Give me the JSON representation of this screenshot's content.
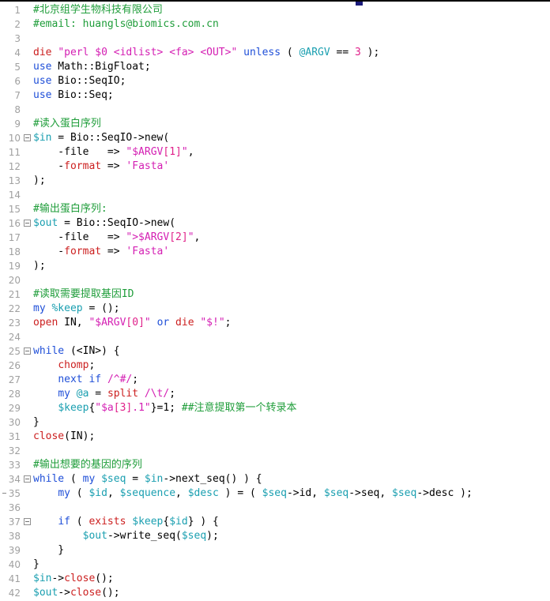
{
  "app": {
    "type": "code-editor",
    "language": "Perl",
    "title": "",
    "top_marker": "tab-marker"
  },
  "colors": {
    "background": "#ffffff",
    "gutter_text": "#a0a0a0",
    "comment": "#1f9d3a",
    "keyword": "#1f4fd8",
    "builtin": "#cc2020",
    "string": "#d41fb3",
    "variable": "#1a9fb0",
    "number": "#e0218a",
    "plain": "#000000",
    "top_marker": "#1a1a7a",
    "fold_border": "#909090"
  },
  "editor": {
    "first_line": 1,
    "last_line": 42,
    "fold_lines": [
      10,
      16,
      25,
      34,
      37
    ],
    "marked_lines": [
      35
    ],
    "lines": [
      {
        "n": 1,
        "tokens": [
          {
            "t": "comment",
            "v": "#北京组学生物科技有限公司"
          }
        ]
      },
      {
        "n": 2,
        "tokens": [
          {
            "t": "comment",
            "v": "#email: huangls@biomics.com.cn"
          }
        ]
      },
      {
        "n": 3,
        "tokens": []
      },
      {
        "n": 4,
        "tokens": [
          {
            "t": "builtin",
            "v": "die"
          },
          {
            "t": "plain",
            "v": " "
          },
          {
            "t": "string",
            "v": "\"perl $0 <idlist> <fa> <OUT>\""
          },
          {
            "t": "plain",
            "v": " "
          },
          {
            "t": "keyword",
            "v": "unless"
          },
          {
            "t": "plain",
            "v": " ( "
          },
          {
            "t": "var",
            "v": "@ARGV"
          },
          {
            "t": "plain",
            "v": " == "
          },
          {
            "t": "num",
            "v": "3"
          },
          {
            "t": "plain",
            "v": " );"
          }
        ]
      },
      {
        "n": 5,
        "tokens": [
          {
            "t": "keyword",
            "v": "use"
          },
          {
            "t": "plain",
            "v": " Math::BigFloat;"
          }
        ]
      },
      {
        "n": 6,
        "tokens": [
          {
            "t": "keyword",
            "v": "use"
          },
          {
            "t": "plain",
            "v": " Bio::SeqIO;"
          }
        ]
      },
      {
        "n": 7,
        "tokens": [
          {
            "t": "keyword",
            "v": "use"
          },
          {
            "t": "plain",
            "v": " Bio::Seq;"
          }
        ]
      },
      {
        "n": 8,
        "tokens": []
      },
      {
        "n": 9,
        "tokens": [
          {
            "t": "comment",
            "v": "#读入蛋白序列"
          }
        ]
      },
      {
        "n": 10,
        "tokens": [
          {
            "t": "var",
            "v": "$in"
          },
          {
            "t": "plain",
            "v": " = Bio::SeqIO->new("
          }
        ]
      },
      {
        "n": 11,
        "tokens": [
          {
            "t": "plain",
            "v": "    -file   => "
          },
          {
            "t": "string",
            "v": "\"$ARGV"
          },
          {
            "t": "num",
            "v": "[1]"
          },
          {
            "t": "string",
            "v": "\""
          },
          {
            "t": "plain",
            "v": ","
          }
        ]
      },
      {
        "n": 12,
        "tokens": [
          {
            "t": "plain",
            "v": "    -"
          },
          {
            "t": "builtin",
            "v": "format"
          },
          {
            "t": "plain",
            "v": " => "
          },
          {
            "t": "string",
            "v": "'Fasta'"
          }
        ]
      },
      {
        "n": 13,
        "tokens": [
          {
            "t": "plain",
            "v": ");"
          }
        ]
      },
      {
        "n": 14,
        "tokens": []
      },
      {
        "n": 15,
        "tokens": [
          {
            "t": "comment",
            "v": "#输出蛋白序列:"
          }
        ]
      },
      {
        "n": 16,
        "tokens": [
          {
            "t": "var",
            "v": "$out"
          },
          {
            "t": "plain",
            "v": " = Bio::SeqIO->new("
          }
        ]
      },
      {
        "n": 17,
        "tokens": [
          {
            "t": "plain",
            "v": "    -file   => "
          },
          {
            "t": "string",
            "v": "\">$ARGV"
          },
          {
            "t": "num",
            "v": "[2]"
          },
          {
            "t": "string",
            "v": "\""
          },
          {
            "t": "plain",
            "v": ","
          }
        ]
      },
      {
        "n": 18,
        "tokens": [
          {
            "t": "plain",
            "v": "    -"
          },
          {
            "t": "builtin",
            "v": "format"
          },
          {
            "t": "plain",
            "v": " => "
          },
          {
            "t": "string",
            "v": "'Fasta'"
          }
        ]
      },
      {
        "n": 19,
        "tokens": [
          {
            "t": "plain",
            "v": ");"
          }
        ]
      },
      {
        "n": 20,
        "tokens": []
      },
      {
        "n": 21,
        "tokens": [
          {
            "t": "comment",
            "v": "#读取需要提取基因ID"
          }
        ]
      },
      {
        "n": 22,
        "tokens": [
          {
            "t": "keyword",
            "v": "my"
          },
          {
            "t": "plain",
            "v": " "
          },
          {
            "t": "var",
            "v": "%keep"
          },
          {
            "t": "plain",
            "v": " = ();"
          }
        ]
      },
      {
        "n": 23,
        "tokens": [
          {
            "t": "builtin",
            "v": "open"
          },
          {
            "t": "plain",
            "v": " IN, "
          },
          {
            "t": "string",
            "v": "\"$ARGV"
          },
          {
            "t": "num",
            "v": "[0]"
          },
          {
            "t": "string",
            "v": "\""
          },
          {
            "t": "plain",
            "v": " "
          },
          {
            "t": "keyword",
            "v": "or"
          },
          {
            "t": "plain",
            "v": " "
          },
          {
            "t": "builtin",
            "v": "die"
          },
          {
            "t": "plain",
            "v": " "
          },
          {
            "t": "string",
            "v": "\"$!\""
          },
          {
            "t": "plain",
            "v": ";"
          }
        ]
      },
      {
        "n": 24,
        "tokens": []
      },
      {
        "n": 25,
        "tokens": [
          {
            "t": "keyword",
            "v": "while"
          },
          {
            "t": "plain",
            "v": " (<IN>) {"
          }
        ]
      },
      {
        "n": 26,
        "tokens": [
          {
            "t": "plain",
            "v": "    "
          },
          {
            "t": "builtin",
            "v": "chomp"
          },
          {
            "t": "plain",
            "v": ";"
          }
        ]
      },
      {
        "n": 27,
        "tokens": [
          {
            "t": "plain",
            "v": "    "
          },
          {
            "t": "keyword",
            "v": "next"
          },
          {
            "t": "plain",
            "v": " "
          },
          {
            "t": "keyword",
            "v": "if"
          },
          {
            "t": "plain",
            "v": " "
          },
          {
            "t": "regex",
            "v": "/^#/"
          },
          {
            "t": "plain",
            "v": ";"
          }
        ]
      },
      {
        "n": 28,
        "tokens": [
          {
            "t": "plain",
            "v": "    "
          },
          {
            "t": "keyword",
            "v": "my"
          },
          {
            "t": "plain",
            "v": " "
          },
          {
            "t": "var",
            "v": "@a"
          },
          {
            "t": "plain",
            "v": " = "
          },
          {
            "t": "builtin",
            "v": "split"
          },
          {
            "t": "plain",
            "v": " "
          },
          {
            "t": "regex",
            "v": "/\\t/"
          },
          {
            "t": "plain",
            "v": ";"
          }
        ]
      },
      {
        "n": 29,
        "tokens": [
          {
            "t": "plain",
            "v": "    "
          },
          {
            "t": "var",
            "v": "$keep"
          },
          {
            "t": "plain",
            "v": "{"
          },
          {
            "t": "string",
            "v": "\"$a"
          },
          {
            "t": "num",
            "v": "[3]"
          },
          {
            "t": "string",
            "v": ".1\""
          },
          {
            "t": "plain",
            "v": "}=1; "
          },
          {
            "t": "comment",
            "v": "##注意提取第一个转录本"
          }
        ]
      },
      {
        "n": 30,
        "tokens": [
          {
            "t": "plain",
            "v": "}"
          }
        ]
      },
      {
        "n": 31,
        "tokens": [
          {
            "t": "builtin",
            "v": "close"
          },
          {
            "t": "plain",
            "v": "(IN);"
          }
        ]
      },
      {
        "n": 32,
        "tokens": []
      },
      {
        "n": 33,
        "tokens": [
          {
            "t": "comment",
            "v": "#输出想要的基因的序列"
          }
        ]
      },
      {
        "n": 34,
        "tokens": [
          {
            "t": "keyword",
            "v": "while"
          },
          {
            "t": "plain",
            "v": " ( "
          },
          {
            "t": "keyword",
            "v": "my"
          },
          {
            "t": "plain",
            "v": " "
          },
          {
            "t": "var",
            "v": "$seq"
          },
          {
            "t": "plain",
            "v": " = "
          },
          {
            "t": "var",
            "v": "$in"
          },
          {
            "t": "plain",
            "v": "->next_seq() ) {"
          }
        ]
      },
      {
        "n": 35,
        "tokens": [
          {
            "t": "plain",
            "v": "    "
          },
          {
            "t": "keyword",
            "v": "my"
          },
          {
            "t": "plain",
            "v": " ( "
          },
          {
            "t": "var",
            "v": "$id"
          },
          {
            "t": "plain",
            "v": ", "
          },
          {
            "t": "var",
            "v": "$sequence"
          },
          {
            "t": "plain",
            "v": ", "
          },
          {
            "t": "var",
            "v": "$desc"
          },
          {
            "t": "plain",
            "v": " ) = ( "
          },
          {
            "t": "var",
            "v": "$seq"
          },
          {
            "t": "plain",
            "v": "->id, "
          },
          {
            "t": "var",
            "v": "$seq"
          },
          {
            "t": "plain",
            "v": "->seq, "
          },
          {
            "t": "var",
            "v": "$seq"
          },
          {
            "t": "plain",
            "v": "->desc );"
          }
        ]
      },
      {
        "n": 36,
        "tokens": []
      },
      {
        "n": 37,
        "tokens": [
          {
            "t": "plain",
            "v": "    "
          },
          {
            "t": "keyword",
            "v": "if"
          },
          {
            "t": "plain",
            "v": " ( "
          },
          {
            "t": "builtin",
            "v": "exists"
          },
          {
            "t": "plain",
            "v": " "
          },
          {
            "t": "var",
            "v": "$keep"
          },
          {
            "t": "plain",
            "v": "{"
          },
          {
            "t": "var",
            "v": "$id"
          },
          {
            "t": "plain",
            "v": "} ) {"
          }
        ]
      },
      {
        "n": 38,
        "tokens": [
          {
            "t": "plain",
            "v": "        "
          },
          {
            "t": "var",
            "v": "$out"
          },
          {
            "t": "plain",
            "v": "->write_seq("
          },
          {
            "t": "var",
            "v": "$seq"
          },
          {
            "t": "plain",
            "v": ");"
          }
        ]
      },
      {
        "n": 39,
        "tokens": [
          {
            "t": "plain",
            "v": "    }"
          }
        ]
      },
      {
        "n": 40,
        "tokens": [
          {
            "t": "plain",
            "v": "}"
          }
        ]
      },
      {
        "n": 41,
        "tokens": [
          {
            "t": "var",
            "v": "$in"
          },
          {
            "t": "plain",
            "v": "->"
          },
          {
            "t": "builtin",
            "v": "close"
          },
          {
            "t": "plain",
            "v": "();"
          }
        ]
      },
      {
        "n": 42,
        "tokens": [
          {
            "t": "var",
            "v": "$out"
          },
          {
            "t": "plain",
            "v": "->"
          },
          {
            "t": "builtin",
            "v": "close"
          },
          {
            "t": "plain",
            "v": "();"
          }
        ]
      }
    ]
  }
}
